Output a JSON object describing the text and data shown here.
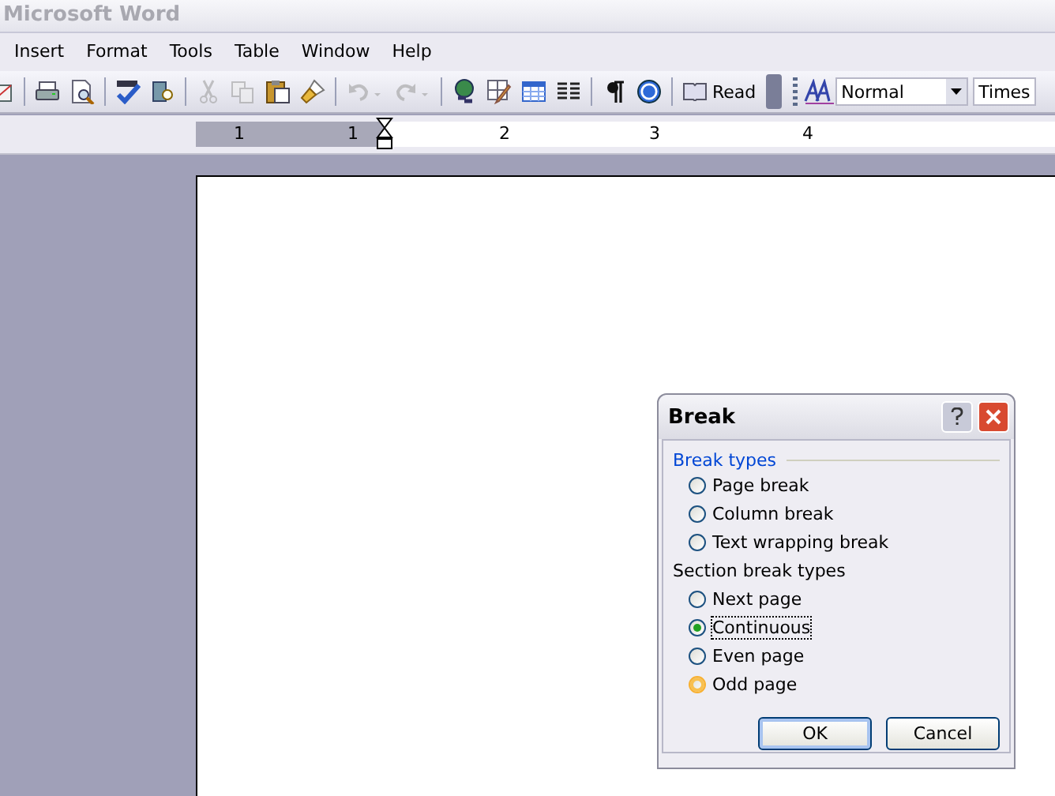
{
  "window": {
    "title": "Microsoft Word"
  },
  "menu": [
    {
      "label": "Insert"
    },
    {
      "label": "Format"
    },
    {
      "label": "Tools"
    },
    {
      "label": "Table"
    },
    {
      "label": "Window"
    },
    {
      "label": "Help"
    }
  ],
  "toolbar": [
    {
      "kind": "email",
      "disabled": false
    },
    {
      "kind": "sep"
    },
    {
      "kind": "print",
      "disabled": false
    },
    {
      "kind": "preview",
      "disabled": false
    },
    {
      "kind": "sep"
    },
    {
      "kind": "spelling",
      "disabled": false
    },
    {
      "kind": "research",
      "disabled": false
    },
    {
      "kind": "sep"
    },
    {
      "kind": "cut",
      "disabled": true
    },
    {
      "kind": "copy",
      "disabled": true
    },
    {
      "kind": "paste",
      "disabled": false
    },
    {
      "kind": "brush",
      "disabled": false
    },
    {
      "kind": "sep"
    },
    {
      "kind": "undo",
      "disabled": true
    },
    {
      "kind": "redo",
      "disabled": true
    },
    {
      "kind": "sep"
    },
    {
      "kind": "link",
      "disabled": false
    },
    {
      "kind": "pencil",
      "disabled": false
    },
    {
      "kind": "table",
      "disabled": false
    },
    {
      "kind": "columns",
      "disabled": false
    },
    {
      "kind": "sep"
    },
    {
      "kind": "pilcrow",
      "disabled": false
    },
    {
      "kind": "help",
      "disabled": false
    },
    {
      "kind": "sep"
    }
  ],
  "read_button": {
    "label": "Read"
  },
  "style_field": {
    "value": "Normal"
  },
  "font_field": {
    "value": "Times"
  },
  "ruler": {
    "labels": [
      "1",
      "1",
      "2",
      "3",
      "4"
    ]
  },
  "dialog": {
    "title": "Break",
    "group": "Break types",
    "section_label": "Section break types",
    "break_types": [
      {
        "label": "Page break",
        "selected": false,
        "focused": false,
        "hovered": false
      },
      {
        "label": "Column break",
        "selected": false,
        "focused": false,
        "hovered": false
      },
      {
        "label": "Text wrapping break",
        "selected": false,
        "focused": false,
        "hovered": false
      }
    ],
    "section_types": [
      {
        "label": "Next page",
        "selected": false,
        "focused": false,
        "hovered": false
      },
      {
        "label": "Continuous",
        "selected": true,
        "focused": true,
        "hovered": false
      },
      {
        "label": "Even page",
        "selected": false,
        "focused": false,
        "hovered": false
      },
      {
        "label": "Odd page",
        "selected": false,
        "focused": false,
        "hovered": true
      }
    ],
    "buttons": [
      {
        "label": "OK",
        "default": true
      },
      {
        "label": "Cancel",
        "default": false
      }
    ]
  }
}
